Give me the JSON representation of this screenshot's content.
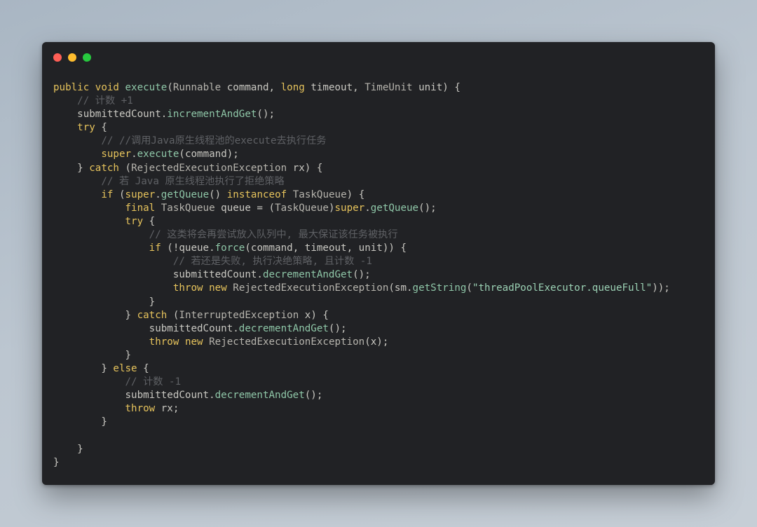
{
  "window": {
    "buttons": [
      {
        "name": "close",
        "color": "#ff5f56"
      },
      {
        "name": "minimize",
        "color": "#ffbd2e"
      },
      {
        "name": "maximize",
        "color": "#27c93f"
      }
    ]
  },
  "code": {
    "lines": [
      [
        [
          "kw",
          "public"
        ],
        [
          "pl",
          " "
        ],
        [
          "kw",
          "void"
        ],
        [
          "pl",
          " "
        ],
        [
          "fn",
          "execute"
        ],
        [
          "pl",
          "("
        ],
        [
          "typ",
          "Runnable"
        ],
        [
          "pl",
          " command, "
        ],
        [
          "kw",
          "long"
        ],
        [
          "pl",
          " timeout, "
        ],
        [
          "typ",
          "TimeUnit"
        ],
        [
          "pl",
          " unit) {"
        ]
      ],
      [
        [
          "pl",
          "    "
        ],
        [
          "cmt",
          "// 计数 +1"
        ]
      ],
      [
        [
          "pl",
          "    submittedCount."
        ],
        [
          "fn",
          "incrementAndGet"
        ],
        [
          "pl",
          "();"
        ]
      ],
      [
        [
          "pl",
          "    "
        ],
        [
          "kw",
          "try"
        ],
        [
          "pl",
          " {"
        ]
      ],
      [
        [
          "pl",
          "        "
        ],
        [
          "cmt",
          "// //调用Java原生线程池的execute去执行任务"
        ]
      ],
      [
        [
          "pl",
          "        "
        ],
        [
          "kw",
          "super"
        ],
        [
          "pl",
          "."
        ],
        [
          "fn",
          "execute"
        ],
        [
          "pl",
          "(command);"
        ]
      ],
      [
        [
          "pl",
          "    } "
        ],
        [
          "kw",
          "catch"
        ],
        [
          "pl",
          " ("
        ],
        [
          "typ",
          "RejectedExecutionException"
        ],
        [
          "pl",
          " rx) {"
        ]
      ],
      [
        [
          "pl",
          "        "
        ],
        [
          "cmt",
          "// 若 Java 原生线程池执行了拒绝策略"
        ]
      ],
      [
        [
          "pl",
          "        "
        ],
        [
          "kw",
          "if"
        ],
        [
          "pl",
          " ("
        ],
        [
          "kw",
          "super"
        ],
        [
          "pl",
          "."
        ],
        [
          "fn",
          "getQueue"
        ],
        [
          "pl",
          "() "
        ],
        [
          "kw",
          "instanceof"
        ],
        [
          "pl",
          " "
        ],
        [
          "typ",
          "TaskQueue"
        ],
        [
          "pl",
          ") {"
        ]
      ],
      [
        [
          "pl",
          "            "
        ],
        [
          "kw",
          "final"
        ],
        [
          "pl",
          " "
        ],
        [
          "typ",
          "TaskQueue"
        ],
        [
          "pl",
          " queue = ("
        ],
        [
          "typ",
          "TaskQueue"
        ],
        [
          "pl",
          ")"
        ],
        [
          "kw",
          "super"
        ],
        [
          "pl",
          "."
        ],
        [
          "fn",
          "getQueue"
        ],
        [
          "pl",
          "();"
        ]
      ],
      [
        [
          "pl",
          "            "
        ],
        [
          "kw",
          "try"
        ],
        [
          "pl",
          " {"
        ]
      ],
      [
        [
          "pl",
          "                "
        ],
        [
          "cmt",
          "// 这类将会再尝试放入队列中, 最大保证该任务被执行"
        ]
      ],
      [
        [
          "pl",
          "                "
        ],
        [
          "kw",
          "if"
        ],
        [
          "pl",
          " (!queue."
        ],
        [
          "fn",
          "force"
        ],
        [
          "pl",
          "(command, timeout, unit)) {"
        ]
      ],
      [
        [
          "pl",
          "                    "
        ],
        [
          "cmt",
          "// 若还是失败, 执行决绝策略, 且计数 -1"
        ]
      ],
      [
        [
          "pl",
          "                    submittedCount."
        ],
        [
          "fn",
          "decrementAndGet"
        ],
        [
          "pl",
          "();"
        ]
      ],
      [
        [
          "pl",
          "                    "
        ],
        [
          "kw",
          "throw"
        ],
        [
          "pl",
          " "
        ],
        [
          "kw",
          "new"
        ],
        [
          "pl",
          " "
        ],
        [
          "typ",
          "RejectedExecutionException"
        ],
        [
          "pl",
          "(sm."
        ],
        [
          "fn",
          "getString"
        ],
        [
          "pl",
          "("
        ],
        [
          "str",
          "\"threadPoolExecutor.queueFull\""
        ],
        [
          "pl",
          "));"
        ]
      ],
      [
        [
          "pl",
          "                }"
        ]
      ],
      [
        [
          "pl",
          "            } "
        ],
        [
          "kw",
          "catch"
        ],
        [
          "pl",
          " ("
        ],
        [
          "typ",
          "InterruptedException"
        ],
        [
          "pl",
          " x) {"
        ]
      ],
      [
        [
          "pl",
          "                submittedCount."
        ],
        [
          "fn",
          "decrementAndGet"
        ],
        [
          "pl",
          "();"
        ]
      ],
      [
        [
          "pl",
          "                "
        ],
        [
          "kw",
          "throw"
        ],
        [
          "pl",
          " "
        ],
        [
          "kw",
          "new"
        ],
        [
          "pl",
          " "
        ],
        [
          "typ",
          "RejectedExecutionException"
        ],
        [
          "pl",
          "(x);"
        ]
      ],
      [
        [
          "pl",
          "            }"
        ]
      ],
      [
        [
          "pl",
          "        } "
        ],
        [
          "kw",
          "else"
        ],
        [
          "pl",
          " {"
        ]
      ],
      [
        [
          "pl",
          "            "
        ],
        [
          "cmt",
          "// 计数 -1"
        ]
      ],
      [
        [
          "pl",
          "            submittedCount."
        ],
        [
          "fn",
          "decrementAndGet"
        ],
        [
          "pl",
          "();"
        ]
      ],
      [
        [
          "pl",
          "            "
        ],
        [
          "kw",
          "throw"
        ],
        [
          "pl",
          " rx;"
        ]
      ],
      [
        [
          "pl",
          "        }"
        ]
      ],
      [
        [
          "pl",
          ""
        ]
      ],
      [
        [
          "pl",
          "    }"
        ]
      ],
      [
        [
          "pl",
          "}"
        ]
      ]
    ]
  }
}
